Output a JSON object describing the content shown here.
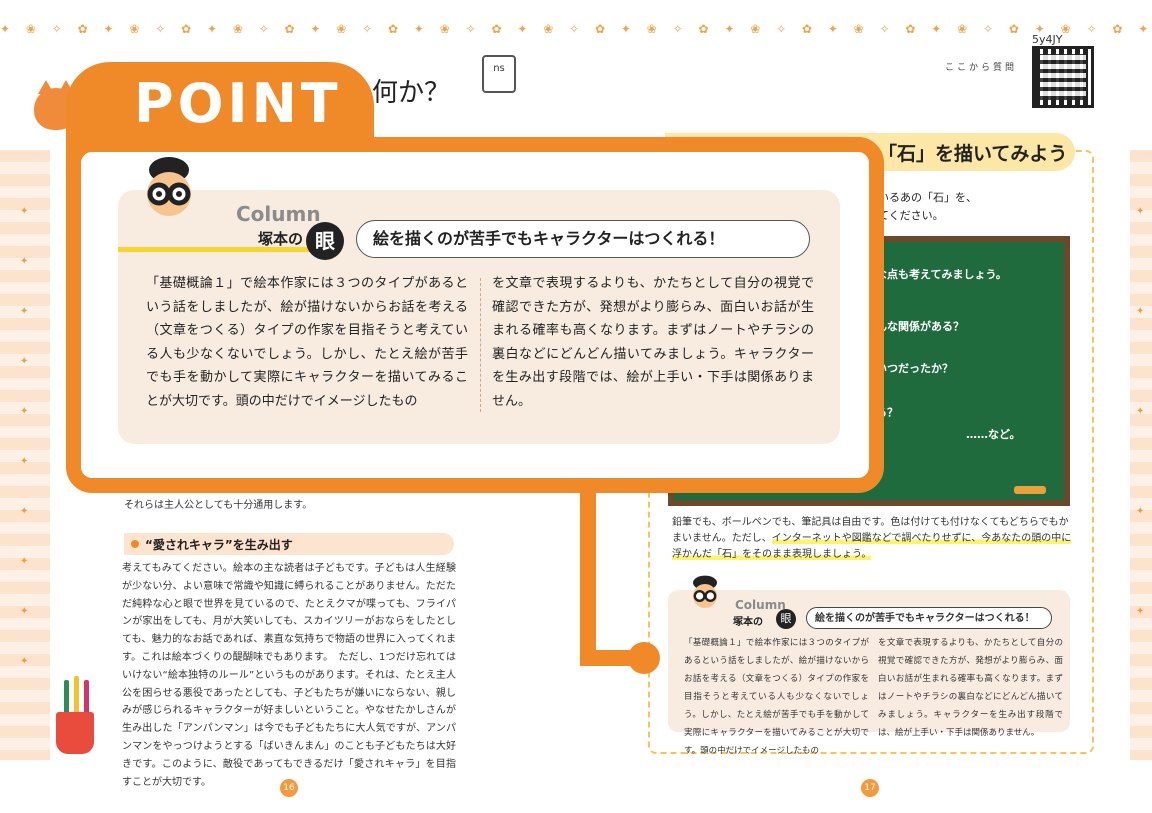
{
  "decor": {
    "garland": "✦ ❀ ✧ ✿ ✦ ❀ ✧ ✿ ✦ ❀ ✧ ✿ ✦ ❀ ✧ ✿ ✦ ❀ ✧ ✿ ✦ ❀ ✧ ✿ ✦ ❀ ✧ ✿ ✦ ❀ ✧ ✿ ✦ ❀ ✧ ✿ ✦ ❀ ✧ ✿ ✦ ❀ ✧ ✿ ✦ ❀ ✧ ✿ ✦ ❀ ✧ ✿ ✦ ❀ ✧ ✿ ✦ ❀ ✧ ✿",
    "side_mark": "✦",
    "leaf_color": "#f0a44a",
    "accent": "#f08a28"
  },
  "header": {
    "heading_tail": "何か？",
    "notebook_label": "ns"
  },
  "qr": {
    "code": "5y4JY",
    "ask_link": "ここから質問"
  },
  "right_page": {
    "section_title": "「石」を描いてみよう",
    "desc_line1": "いるあの「石」を、",
    "desc_line2": "てください。",
    "board_lines": [
      "な点も考えてみましょう。",
      "んな関係がある？",
      "いつだったか？",
      "る？",
      "……など。"
    ],
    "note_part1": "鉛筆でも、ボールペンでも、筆記具は自由です。色は付けても付けなくてもどちらでもかまいません。ただし、",
    "note_highlight": "インターネットや図鑑などで調べたりせずに、今あなたの頭の中に浮かんだ「石」をそのまま表現しましょう。",
    "column_small": {
      "brand": "Column",
      "sub": "塚本の",
      "eye": "眼",
      "heading": "絵を描くのが苦手でもキャラクターはつくれる！",
      "para_left": "「基礎概論１」で絵本作家には３つのタイプがあるという話をしましたが、絵が描けないからお話を考える（文章をつくる）タイプの作家を目指そうと考えている人も少なくないでしょう。しかし、たとえ絵が苦手でも手を動かして実際にキャラクターを描いてみることが大切です。頭の中だけでイメージしたもの",
      "para_right": "を文章で表現するよりも、かたちとして自分の視覚で確認できた方が、発想がより膨らみ、面白いお話が生まれる確率も高くなります。まずはノートやチラシの裏白などにどんどん描いてみましょう。キャラクターを生み出す段階では、絵が上手い・下手は関係ありません。"
    }
  },
  "left_page": {
    "line1": "それらは主人公としても十分通用します。",
    "subheading": "“愛されキャラ”を生み出す",
    "paragraph": "考えてもみてください。絵本の主な読者は子どもです。子どもは人生経験が少ない分、よい意味で常識や知識に縛られることがありません。ただただ純粋な心と眼で世界を見ているので、たとえクマが喋っても、フライパンが家出をしても、月が大笑いしても、スカイツリーがおならをしたとしても、魅力的なお話であれば、素直な気持ちで物語の世界に入ってくれます。これは絵本づくりの醍醐味でもあります。　ただし、1つだけ忘れてはいけない“絵本独特のルール”というものがあります。それは、たとえ主人公を困らせる悪役であったとしても、子どもたちが嫌いにならない、親しみが感じられるキャラクターが好ましいということ。やなせたかしさんが生み出した「アンパンマン」は今でも子どもたちに大人気ですが、アンパンマンをやっつけようとする「ばいきんまん」のことも子どもたちは大好きです。このように、敵役であってもできるだけ「愛されキャラ」を目指すことが大切です。"
  },
  "page_numbers": {
    "left": "16",
    "right": "17"
  },
  "point": {
    "label": "POINT",
    "column": {
      "brand": "Column",
      "sub": "塚本の",
      "eye": "眼",
      "heading": "絵を描くのが苦手でもキャラクターはつくれる！",
      "para_left": "「基礎概論１」で絵本作家には３つのタイプがあるという話をしましたが、絵が描けないからお話を考える（文章をつくる）タイプの作家を目指そうと考えている人も少なくないでしょう。しかし、たとえ絵が苦手でも手を動かして実際にキャラクターを描いてみることが大切です。頭の中だけでイメージしたもの",
      "para_right": "を文章で表現するよりも、かたちとして自分の視覚で確認できた方が、発想がより膨らみ、面白いお話が生まれる確率も高くなります。まずはノートやチラシの裏白などにどんどん描いてみましょう。キャラクターを生み出す段階では、絵が上手い・下手は関係ありません。"
    }
  }
}
